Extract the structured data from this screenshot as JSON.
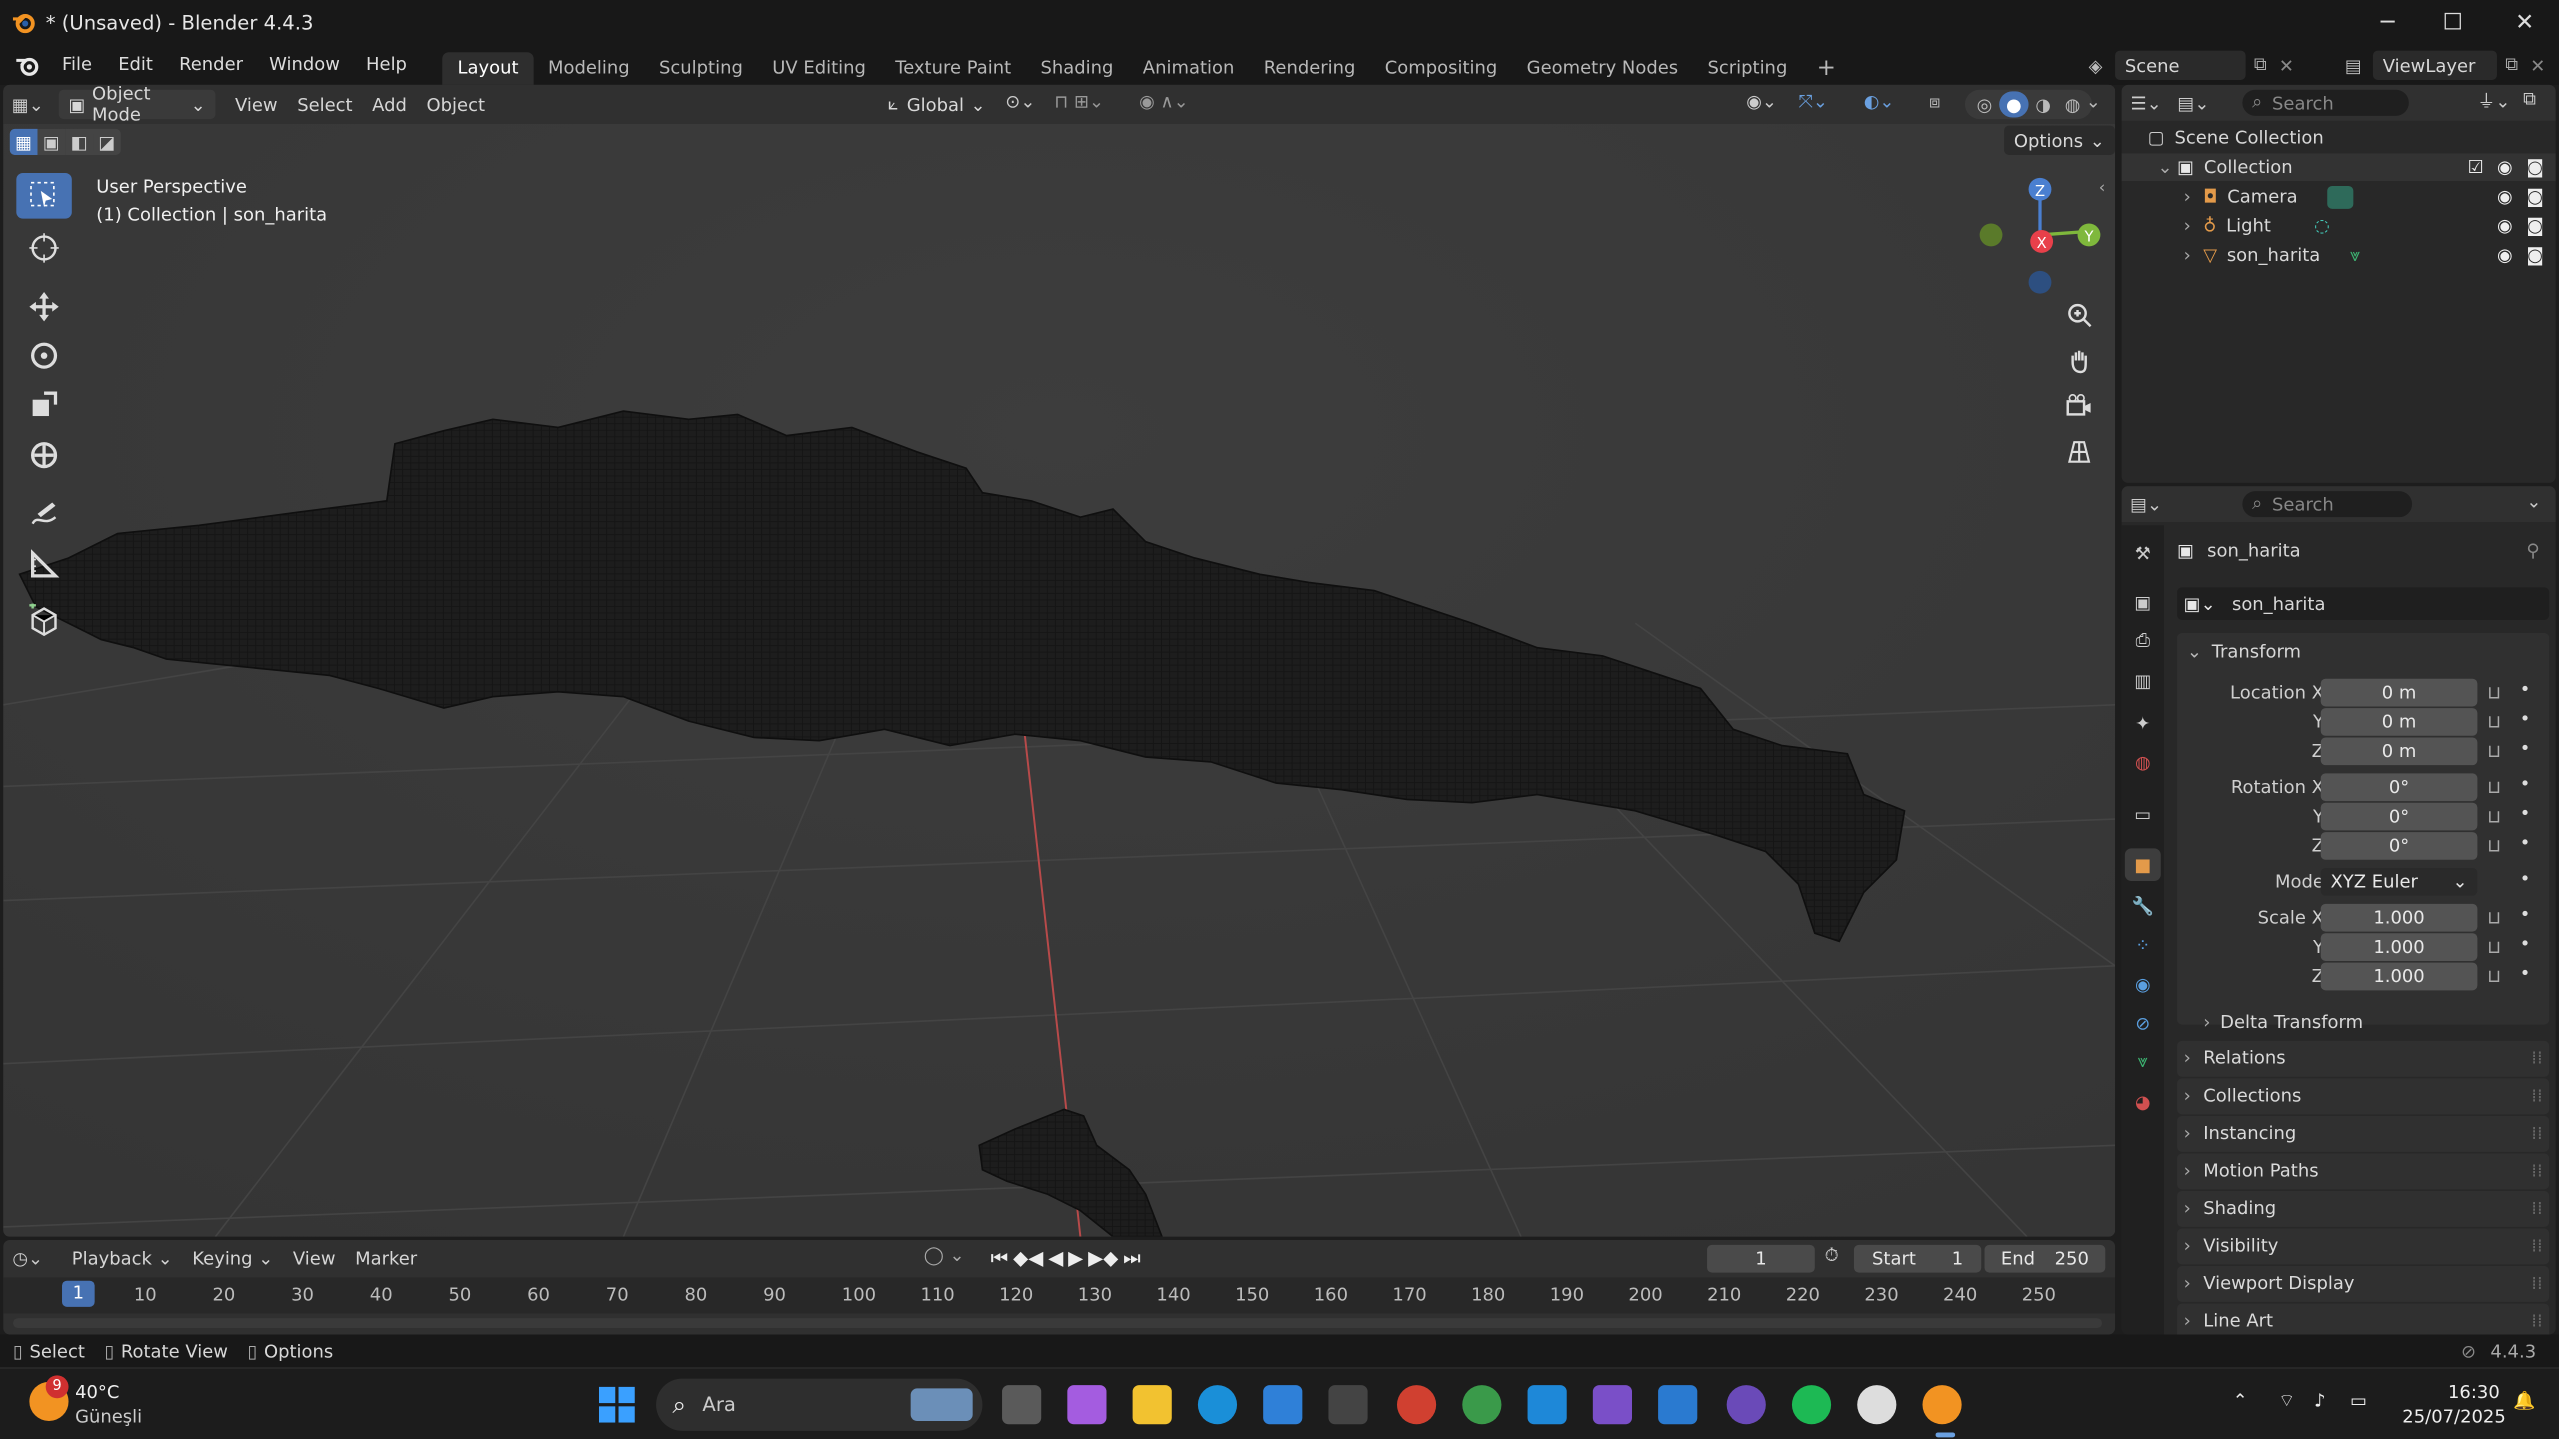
{
  "window": {
    "title": "* (Unsaved) - Blender 4.4.3",
    "minimize": "─",
    "maximize": "☐",
    "close": "✕"
  },
  "menu": {
    "items": [
      "File",
      "Edit",
      "Render",
      "Window",
      "Help"
    ]
  },
  "workspaces": {
    "tabs": [
      "Layout",
      "Modeling",
      "Sculpting",
      "UV Editing",
      "Texture Paint",
      "Shading",
      "Animation",
      "Rendering",
      "Compositing",
      "Geometry Nodes",
      "Scripting"
    ],
    "active": "Layout",
    "add": "+"
  },
  "scene": {
    "label": "Scene",
    "view_layer": "ViewLayer"
  },
  "viewport": {
    "mode": "Object Mode",
    "menus": [
      "View",
      "Select",
      "Add",
      "Object"
    ],
    "orientation": "Global",
    "options": "Options",
    "overlay_title": "User Perspective",
    "overlay_sub": "(1) Collection | son_harita",
    "gizmo": {
      "x": "X",
      "y": "Y",
      "z": "Z"
    }
  },
  "outliner": {
    "search_placeholder": "Search",
    "root": "Scene Collection",
    "collection": "Collection",
    "objects": [
      "Camera",
      "Light",
      "son_harita"
    ]
  },
  "properties": {
    "search_placeholder": "Search",
    "object_name": "son_harita",
    "data_name": "son_harita",
    "transform_title": "Transform",
    "location_label": "Location X",
    "rotation_label": "Rotation X",
    "scale_label": "Scale X",
    "y_label": "Y",
    "z_label": "Z",
    "location": [
      "0 m",
      "0 m",
      "0 m"
    ],
    "rotation": [
      "0°",
      "0°",
      "0°"
    ],
    "mode_label": "Mode",
    "mode_value": "XYZ Euler",
    "scale": [
      "1.000",
      "1.000",
      "1.000"
    ],
    "delta": "Delta Transform",
    "panels": [
      "Relations",
      "Collections",
      "Instancing",
      "Motion Paths",
      "Shading",
      "Visibility",
      "Viewport Display",
      "Line Art"
    ]
  },
  "timeline": {
    "menus": [
      "Playback",
      "Keying",
      "View",
      "Marker"
    ],
    "current_frame": "1",
    "start_label": "Start",
    "start": "1",
    "end_label": "End",
    "end": "250",
    "ticks": [
      "10",
      "20",
      "30",
      "40",
      "50",
      "60",
      "70",
      "80",
      "90",
      "100",
      "110",
      "120",
      "130",
      "140",
      "150",
      "160",
      "170",
      "180",
      "190",
      "200",
      "210",
      "220",
      "230",
      "240",
      "250"
    ],
    "playhead": "1"
  },
  "statusbar": {
    "select": "Select",
    "rotate": "Rotate View",
    "options": "Options",
    "version": "4.4.3"
  },
  "taskbar": {
    "weather_badge": "9",
    "temp": "40°C",
    "weather": "Güneşli",
    "search": "Ara",
    "time": "16:30",
    "date": "25/07/2025"
  }
}
